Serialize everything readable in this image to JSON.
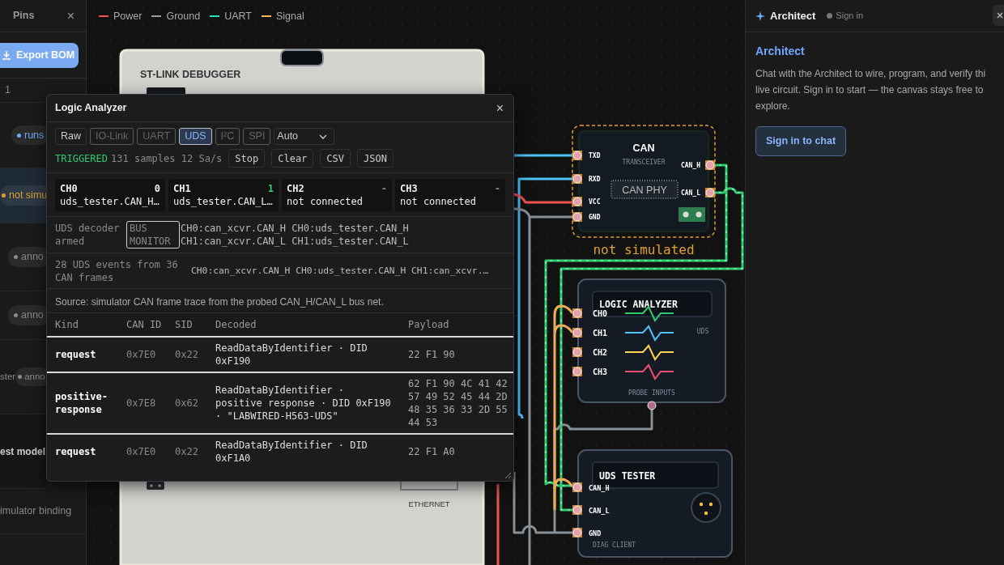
{
  "sidebar": {
    "title": "Pins",
    "close": "×",
    "export_button": "Export BOM",
    "rows": [
      {
        "kind": "text",
        "text": "1",
        "selected": false
      },
      {
        "kind": "pill",
        "text": "runs",
        "color": "#6ea8fe",
        "selected": false
      },
      {
        "kind": "pill",
        "text": "not simu",
        "color": "#e0a030",
        "selected": true
      },
      {
        "kind": "pill",
        "text": "anno",
        "color": "#8a8a8a",
        "selected": false
      },
      {
        "kind": "pill",
        "text": "anno",
        "color": "#8a8a8a",
        "selected": false
      },
      {
        "kind": "text_pill",
        "text": "ster",
        "pill": "anno",
        "color": "#8a8a8a",
        "selected": false
      },
      {
        "kind": "heading",
        "text": "est model",
        "selected": false
      },
      {
        "kind": "text",
        "text": "imulator binding",
        "selected": false
      }
    ]
  },
  "canvas": {
    "legend": [
      {
        "label": "Power",
        "color": "#ef5350"
      },
      {
        "label": "Ground",
        "color": "#9e9e9e"
      },
      {
        "label": "UART",
        "color": "#1de9b6"
      },
      {
        "label": "Signal",
        "color": "#ffb74d"
      }
    ],
    "board": {
      "title": "ST-LINK DEBUGGER",
      "port_label": "ETHERNET"
    },
    "transceiver": {
      "title": "CAN",
      "subtitle": "TRANSCEIVER",
      "chip": "CAN PHY",
      "left_pins": [
        "TXD",
        "RXD",
        "VCC",
        "GND"
      ],
      "right_pins": [
        "CAN_H",
        "CAN_L"
      ],
      "simulated": false,
      "status": "not simulated"
    },
    "analyzer_node": {
      "title": "LOGIC ANALYZER",
      "tag": "UDS",
      "footer": "PROBE INPUTS",
      "channels": [
        {
          "label": "CH0",
          "color": "#2ecc71"
        },
        {
          "label": "CH1",
          "color": "#4fc3f7"
        },
        {
          "label": "CH2",
          "color": "#ffd54f"
        },
        {
          "label": "CH3",
          "color": "#f0506e"
        }
      ]
    },
    "tester_node": {
      "title": "UDS TESTER",
      "pins": [
        "CAN_H",
        "CAN_L",
        "GND"
      ],
      "footer": "DIAG CLIENT"
    }
  },
  "analyzer": {
    "title": "Logic Analyzer",
    "close": "×",
    "modes": [
      {
        "label": "Raw",
        "selected": false,
        "disabled": false
      },
      {
        "label": "IO-Link",
        "selected": false,
        "disabled": true
      },
      {
        "label": "UART",
        "selected": false,
        "disabled": true
      },
      {
        "label": "UDS",
        "selected": true,
        "disabled": false
      },
      {
        "label": "I²C",
        "selected": false,
        "disabled": true
      },
      {
        "label": "SPI",
        "selected": false,
        "disabled": true
      }
    ],
    "select": {
      "value": "Auto"
    },
    "status": "TRIGGERED",
    "stats": "131 samples 12 Sa/s",
    "actions": [
      "Stop",
      "Clear",
      "CSV",
      "JSON"
    ],
    "channels": [
      {
        "name": "CH0",
        "value": "0",
        "connected": true,
        "high": false,
        "net": "uds_tester.CAN_H…"
      },
      {
        "name": "CH1",
        "value": "1",
        "connected": true,
        "high": true,
        "net": "uds_tester.CAN_L…"
      },
      {
        "name": "CH2",
        "value": "-",
        "connected": false,
        "net": "not connected"
      },
      {
        "name": "CH3",
        "value": "-",
        "connected": false,
        "net": "not connected"
      }
    ],
    "decoder": {
      "status": "UDS decoder armed",
      "badge": "BUS MONITOR",
      "nets": [
        "CH0:can_xcvr.CAN_H CH0:uds_tester.CAN_H",
        "CH1:can_xcvr.CAN_L CH1:uds_tester.CAN_L"
      ]
    },
    "summary": {
      "text": "28 UDS events from 36 CAN frames",
      "nets": "CH0:can_xcvr.CAN_H CH0:uds_tester.CAN_H CH1:can_xcvr.…"
    },
    "source": "Source: simulator CAN frame trace from the probed CAN_H/CAN_L bus net.",
    "table": {
      "columns": [
        "Kind",
        "CAN ID",
        "SID",
        "Decoded",
        "Payload"
      ],
      "rows": [
        {
          "kind": "request",
          "can_id": "0x7E0",
          "sid": "0x22",
          "decoded": "ReadDataByIdentifier · DID 0xF190",
          "payload": "22 F1 90"
        },
        {
          "kind": "positive-response",
          "can_id": "0x7E8",
          "sid": "0x62",
          "decoded": "ReadDataByIdentifier · positive response · DID 0xF190 · \"LABWIRED-H563-UDS\"",
          "payload": "62 F1 90 4C 41 42 57 49 52 45 44 2D 48 35 36 33 2D 55 44 53"
        },
        {
          "kind": "request",
          "can_id": "0x7E0",
          "sid": "0x22",
          "decoded": "ReadDataByIdentifier · DID 0xF1A0",
          "payload": "22 F1 A0"
        }
      ]
    }
  },
  "architect": {
    "title": "Architect",
    "status": "Sign in",
    "online": false,
    "heading": "Architect",
    "lines": [
      "Chat with the Architect to wire, program, and verify thi",
      "live circuit. Sign in to start — the canvas stays free to",
      "explore."
    ],
    "button": "Sign in to chat"
  }
}
